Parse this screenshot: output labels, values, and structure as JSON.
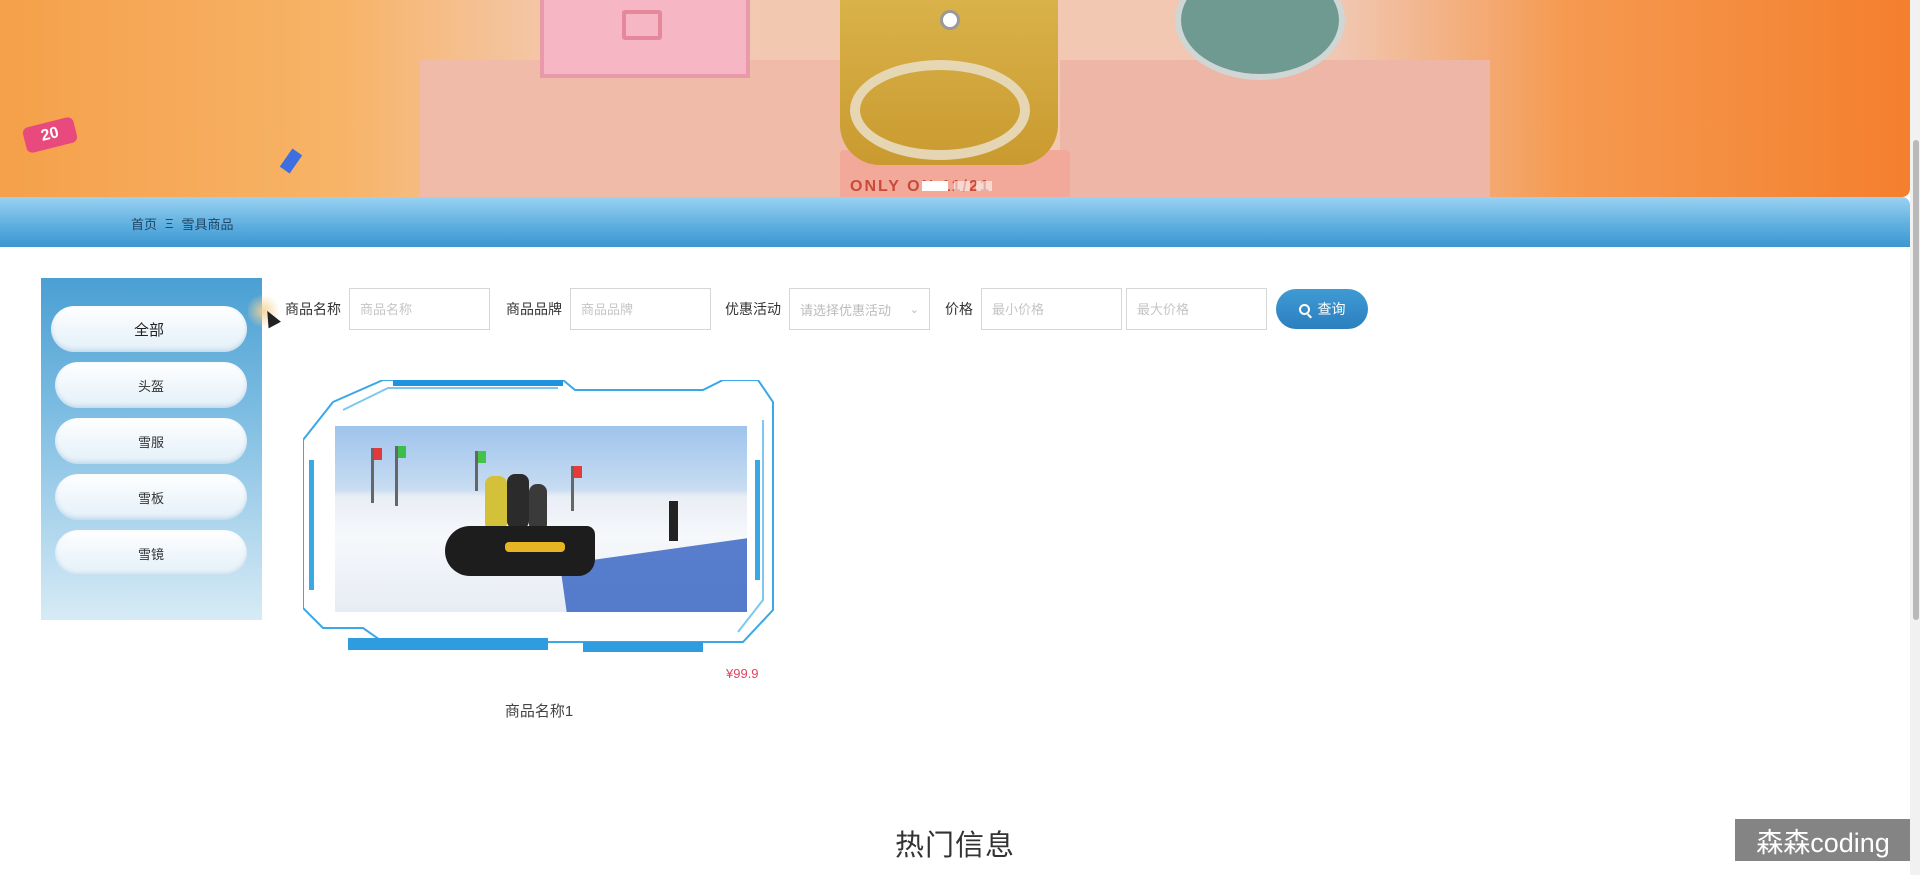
{
  "breadcrumb": {
    "home": "首页",
    "separator": "Ξ",
    "current": "雪具商品"
  },
  "banner": {
    "badge": "20",
    "promo_text": "ONLY ON 11/21",
    "active_slide": 1,
    "slide_count": 3
  },
  "sidebar": {
    "items": [
      {
        "label": "全部",
        "active": true
      },
      {
        "label": "头盔",
        "active": false
      },
      {
        "label": "雪服",
        "active": false
      },
      {
        "label": "雪板",
        "active": false
      },
      {
        "label": "雪镜",
        "active": false
      }
    ]
  },
  "search": {
    "name_label": "商品名称",
    "name_placeholder": "商品名称",
    "brand_label": "商品品牌",
    "brand_placeholder": "商品品牌",
    "activity_label": "优惠活动",
    "activity_placeholder": "请选择优惠活动",
    "price_label": "价格",
    "min_placeholder": "最小价格",
    "max_placeholder": "最大价格",
    "query_button": "查询"
  },
  "products": [
    {
      "name": "商品名称1",
      "price": "¥99.9"
    }
  ],
  "hot_section": {
    "title": "热门信息"
  },
  "watermark": "森森coding",
  "colors": {
    "primary": "#2b7fbe",
    "price": "#e0455e"
  }
}
